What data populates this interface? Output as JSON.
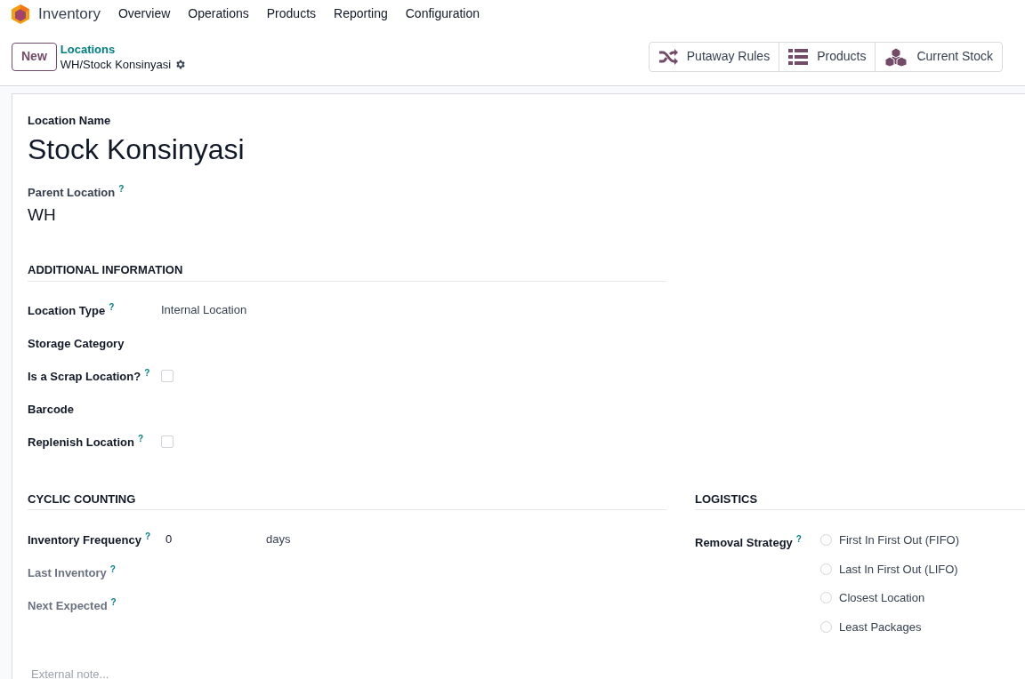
{
  "navbar": {
    "app_name": "Inventory",
    "menu": [
      "Overview",
      "Operations",
      "Products",
      "Reporting",
      "Configuration"
    ]
  },
  "control_panel": {
    "new_button": "New",
    "breadcrumb_parent": "Locations",
    "breadcrumb_current": "WH/Stock Konsinyasi",
    "smart_buttons": [
      {
        "kind": "shuffle",
        "label": "Putaway Rules"
      },
      {
        "kind": "list",
        "label": "Products"
      },
      {
        "kind": "cubes",
        "label": "Current Stock"
      }
    ]
  },
  "form": {
    "name_label": "Location Name",
    "name": "Stock Konsinyasi",
    "parent_label": "Parent Location",
    "parent_help": "?",
    "parent": "WH",
    "additional": {
      "title": "ADDITIONAL INFORMATION",
      "fields": [
        {
          "kind": "text",
          "label": "Location Type",
          "help": "?",
          "value": "Internal Location"
        },
        {
          "kind": "text",
          "label": "Storage Category"
        },
        {
          "kind": "checkbox",
          "label": "Is a Scrap Location?",
          "help": "?",
          "checked": false
        },
        {
          "kind": "text",
          "label": "Barcode"
        },
        {
          "kind": "checkbox",
          "label": "Replenish Location",
          "help": "?",
          "checked": false
        }
      ]
    },
    "cyclic": {
      "title": "CYCLIC COUNTING",
      "fields": [
        {
          "kind": "number",
          "label": "Inventory Frequency",
          "help": "?",
          "value": "0",
          "unit": "days",
          "muted": false
        },
        {
          "kind": "text",
          "label": "Last Inventory",
          "help": "?",
          "muted": true
        },
        {
          "kind": "text",
          "label": "Next Expected",
          "help": "?",
          "muted": true
        }
      ]
    },
    "logistics": {
      "title": "LOGISTICS",
      "label": "Removal Strategy",
      "help": "?",
      "options": [
        {
          "label": "First In First Out (FIFO)",
          "selected": false
        },
        {
          "label": "Last In First Out (LIFO)",
          "selected": false
        },
        {
          "label": "Closest Location",
          "selected": false
        },
        {
          "label": "Least Packages",
          "selected": false
        }
      ]
    },
    "note_placeholder": "External note..."
  }
}
